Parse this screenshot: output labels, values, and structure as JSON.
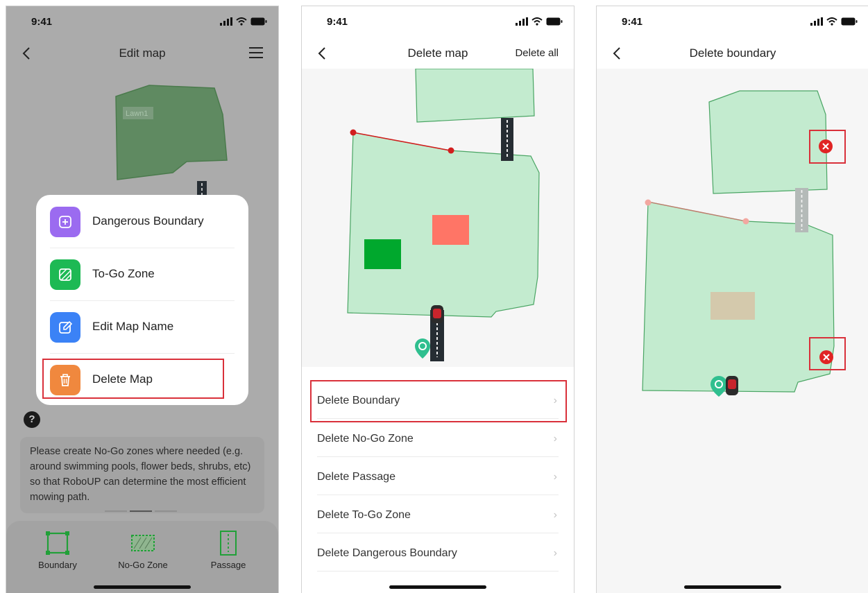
{
  "screens": [
    {
      "status_time": "9:41",
      "nav_title": "Edit map",
      "map_label": "Lawn1",
      "menu": [
        {
          "label": "Dangerous Boundary",
          "icon": "plus-square-icon",
          "color": "#9b6bf0"
        },
        {
          "label": "To-Go Zone",
          "icon": "hatch-icon",
          "color": "#1db954"
        },
        {
          "label": "Edit Map Name",
          "icon": "edit-icon",
          "color": "#3b82f6"
        },
        {
          "label": "Delete Map",
          "icon": "trash-icon",
          "color": "#f0883e"
        }
      ],
      "help_label": "?",
      "tip_text": "Please create No-Go zones where needed (e.g. around swimming pools, flower beds, shrubs, etc) so that  RoboUP can determine the most efficient mowing path.",
      "tools": [
        {
          "label": "Boundary",
          "icon": "boundary-icon"
        },
        {
          "label": "No-Go Zone",
          "icon": "no-go-zone-icon"
        },
        {
          "label": "Passage",
          "icon": "passage-icon"
        }
      ]
    },
    {
      "status_time": "9:41",
      "nav_title": "Delete map",
      "nav_right": "Delete all",
      "items": [
        {
          "label": "Delete Boundary"
        },
        {
          "label": "Delete No-Go Zone"
        },
        {
          "label": "Delete Passage"
        },
        {
          "label": "Delete To-Go Zone"
        },
        {
          "label": "Delete Dangerous Boundary"
        }
      ],
      "chevron": "›"
    },
    {
      "status_time": "9:41",
      "nav_title": "Delete boundary"
    }
  ],
  "colors": {
    "lawn_fill": "#c3ebcf",
    "lawn_stroke": "#4aa564",
    "highlight": "#d9303a",
    "togo_zone": "#00a82d",
    "nogo_zone": "#ff7566",
    "delete_badge": "#e02424"
  }
}
